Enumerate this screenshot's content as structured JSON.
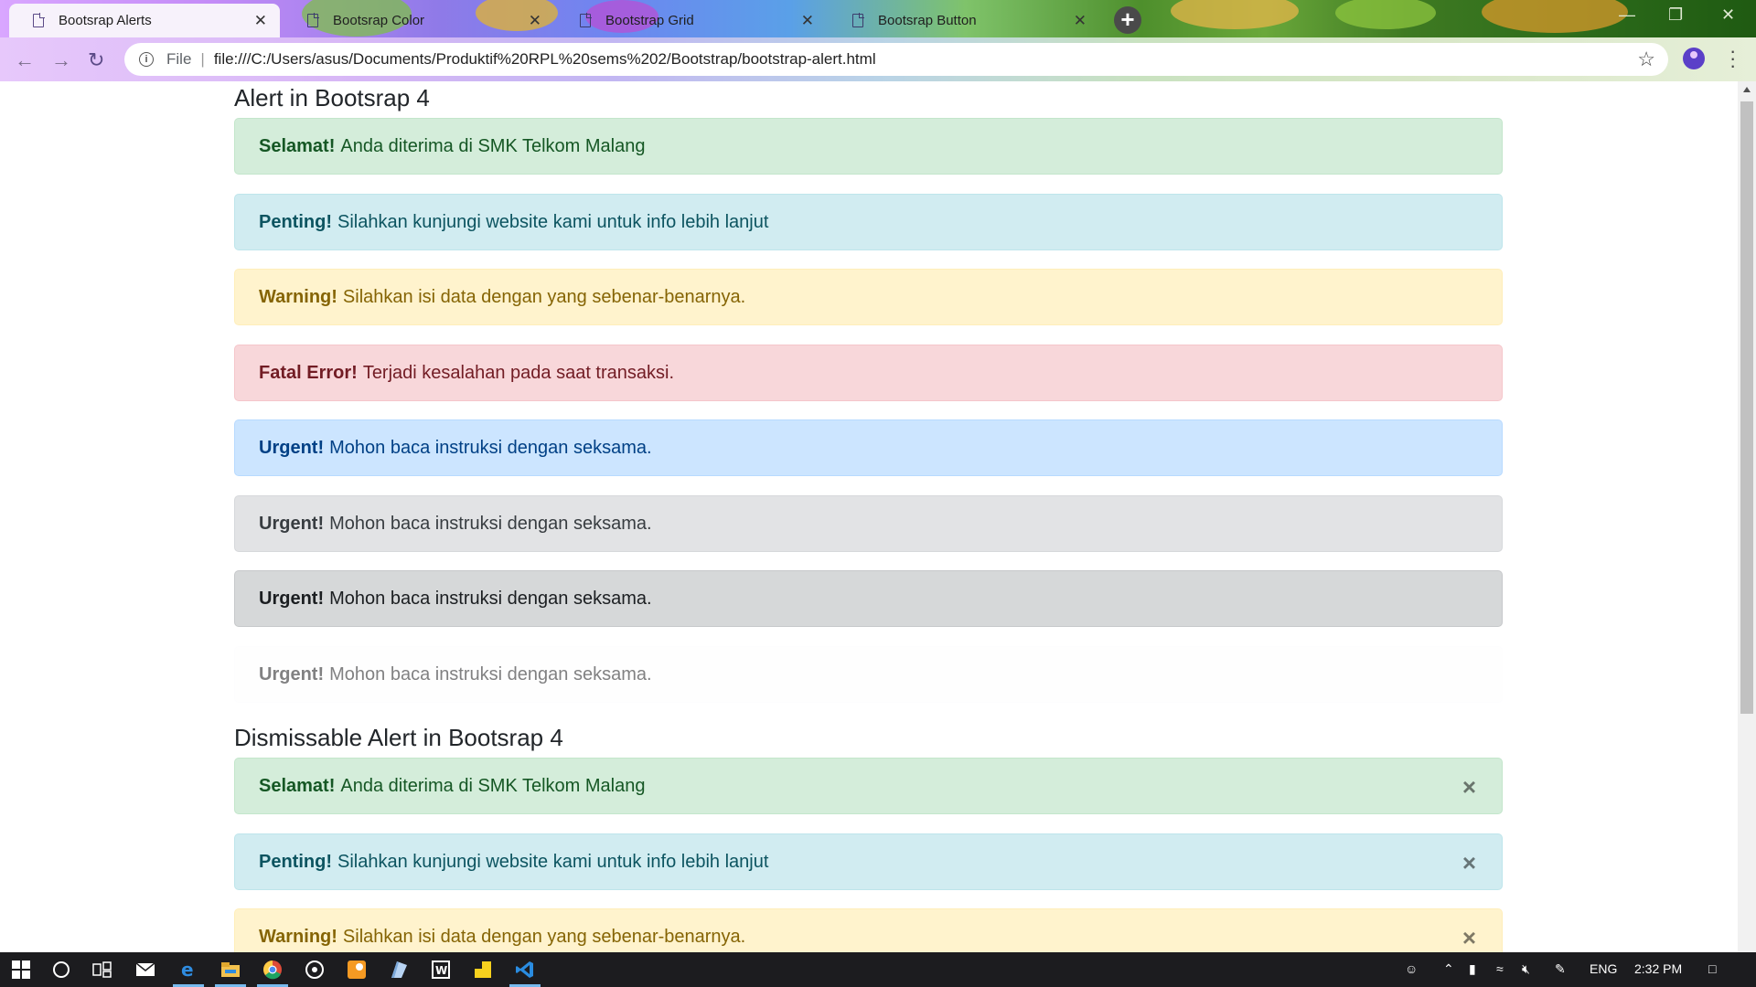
{
  "browser": {
    "tabs": [
      {
        "label": "Bootsrap Alerts",
        "active": true
      },
      {
        "label": "Bootsrap Color",
        "active": false
      },
      {
        "label": "Bootstrap Grid",
        "active": false
      },
      {
        "label": "Bootsrap Button",
        "active": false
      }
    ],
    "close_glyph": "✕",
    "new_tab_glyph": "+",
    "address": {
      "scheme_label": "File",
      "url": "file:///C:/Users/asus/Documents/Produktif%20RPL%20sems%202/Bootstrap/bootstrap-alert.html"
    },
    "icons": {
      "back": "arrow-left-icon",
      "forward": "arrow-right-icon",
      "reload": "reload-icon",
      "info": "info-icon",
      "star": "star-icon",
      "profile": "profile-icon",
      "menu": "kebab-menu-icon"
    }
  },
  "page": {
    "section1_title": "Alert in Bootsrap 4",
    "alerts": [
      {
        "strong": "Selamat!",
        "text": "Anda diterima di SMK Telkom Malang",
        "variant": "success"
      },
      {
        "strong": "Penting!",
        "text": "Silahkan kunjungi website kami untuk info lebih lanjut",
        "variant": "info"
      },
      {
        "strong": "Warning!",
        "text": "Silahkan isi data dengan yang sebenar-benarnya.",
        "variant": "warning"
      },
      {
        "strong": "Fatal Error!",
        "text": "Terjadi kesalahan pada saat transaksi.",
        "variant": "danger"
      },
      {
        "strong": "Urgent!",
        "text": "Mohon baca instruksi dengan seksama.",
        "variant": "primary"
      },
      {
        "strong": "Urgent!",
        "text": "Mohon baca instruksi dengan seksama.",
        "variant": "secondary"
      },
      {
        "strong": "Urgent!",
        "text": "Mohon baca instruksi dengan seksama.",
        "variant": "dark"
      },
      {
        "strong": "Urgent!",
        "text": "Mohon baca instruksi dengan seksama.",
        "variant": "light"
      }
    ],
    "section2_title": "Dismissable Alert in Bootsrap 4",
    "dismissable_alerts": [
      {
        "strong": "Selamat!",
        "text": "Anda diterima di SMK Telkom Malang",
        "variant": "success"
      },
      {
        "strong": "Penting!",
        "text": "Silahkan kunjungi website kami untuk info lebih lanjut",
        "variant": "info"
      },
      {
        "strong": "Warning!",
        "text": "Silahkan isi data dengan yang sebenar-benarnya.",
        "variant": "warning"
      }
    ],
    "dismiss_glyph": "×"
  },
  "taskbar": {
    "apps": [
      "windows-start-icon",
      "cortana-icon",
      "task-view-icon",
      "mail-icon",
      "edge-icon",
      "file-explorer-icon",
      "chrome-icon",
      "media-icon",
      "paint-icon",
      "notes-app-icon",
      "word-icon",
      "sticky-notes-icon",
      "vscode-icon"
    ],
    "language": "ENG",
    "time": "2:32 PM"
  },
  "colors": {
    "success_bg": "#d4edda",
    "info_bg": "#d1ecf1",
    "warning_bg": "#fff3cd",
    "danger_bg": "#f8d7da",
    "primary_bg": "#cce5ff",
    "secondary_bg": "#e2e3e5",
    "dark_bg": "#d6d8d9",
    "light_bg": "#fefefe",
    "taskbar": "#1c1c1f"
  }
}
